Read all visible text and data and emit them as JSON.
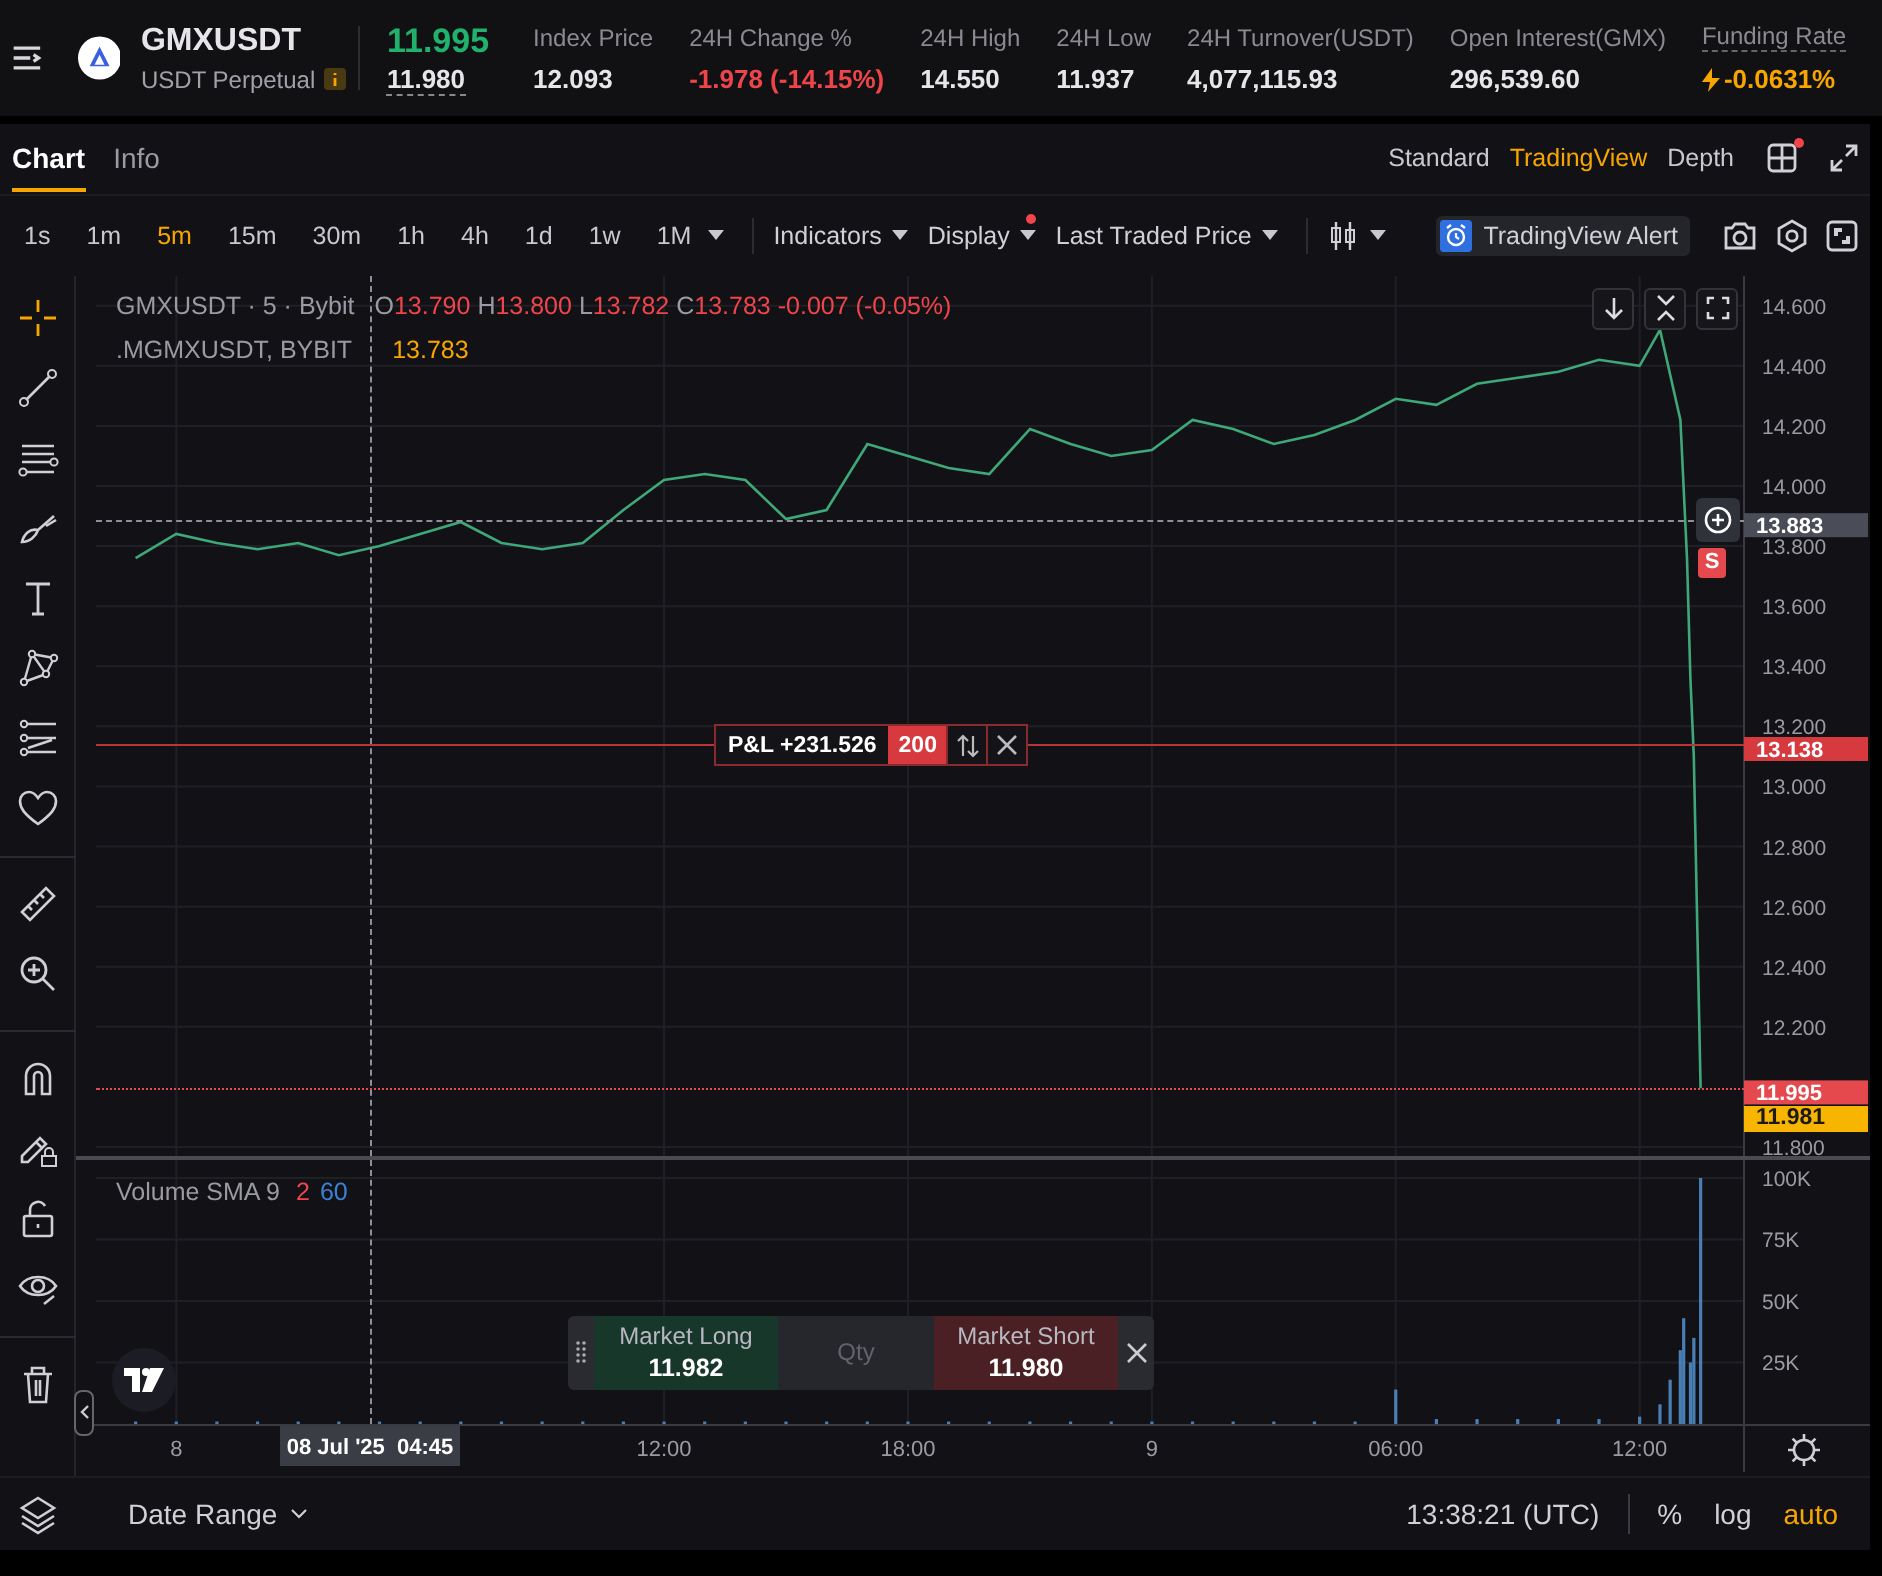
{
  "header": {
    "symbol": "GMXUSDT",
    "contract": "USDT Perpetual",
    "last_price": "11.995",
    "mark_price": "11.980",
    "stats": [
      {
        "label": "Index Price",
        "value": "12.093",
        "kind": "plain"
      },
      {
        "label": "24H Change %",
        "value": "-1.978 (-14.15%)",
        "kind": "down"
      },
      {
        "label": "24H High",
        "value": "14.550",
        "kind": "plain"
      },
      {
        "label": "24H Low",
        "value": "11.937",
        "kind": "plain"
      },
      {
        "label": "24H Turnover(USDT)",
        "value": "4,077,115.93",
        "kind": "plain"
      },
      {
        "label": "Open Interest(GMX)",
        "value": "296,539.60",
        "kind": "plain"
      },
      {
        "label": "Funding Rate",
        "value": "-0.0631%",
        "kind": "funding"
      }
    ]
  },
  "tabs": [
    {
      "label": "Chart",
      "selected": true
    },
    {
      "label": "Info",
      "selected": false
    }
  ],
  "views": [
    {
      "label": "Standard",
      "selected": false
    },
    {
      "label": "TradingView",
      "selected": true
    },
    {
      "label": "Depth",
      "selected": false
    }
  ],
  "layout_badge": true,
  "intervals": [
    {
      "label": "1s",
      "selected": false
    },
    {
      "label": "1m",
      "selected": false
    },
    {
      "label": "5m",
      "selected": true
    },
    {
      "label": "15m",
      "selected": false
    },
    {
      "label": "30m",
      "selected": false
    },
    {
      "label": "1h",
      "selected": false
    },
    {
      "label": "4h",
      "selected": false
    },
    {
      "label": "1d",
      "selected": false
    },
    {
      "label": "1w",
      "selected": false
    },
    {
      "label": "1M",
      "selected": false
    }
  ],
  "toolbar": {
    "indicators": "Indicators",
    "display": "Display",
    "display_badge": true,
    "price_source": "Last Traded Price",
    "alert": "TradingView Alert"
  },
  "legend": {
    "title": "GMXUSDT · 5 · Bybit",
    "ohlc": [
      {
        "prefix": "O",
        "value": "13.790"
      },
      {
        "prefix": "H",
        "value": "13.800"
      },
      {
        "prefix": "L",
        "value": "13.782"
      },
      {
        "prefix": "C",
        "value": "13.783"
      }
    ],
    "change": "-0.007 (-0.05%)",
    "index_name": ".MGMXUSDT, BYBIT",
    "index_value": "13.783"
  },
  "price_tags": [
    {
      "kind": "crosshair",
      "value": "13.883"
    },
    {
      "kind": "position",
      "value": "13.138"
    },
    {
      "kind": "last",
      "value": "11.995"
    }
  ],
  "crosshair_time": "08 Jul '25  04:45",
  "mark_tag": "11.981",
  "position": {
    "pnl": "P&L +231.526",
    "qty": "200"
  },
  "sell_marker": "S",
  "price_chart": {
    "chart_data": {
      "type": "line",
      "grid": true,
      "x": [
        "2025-07-07T23:00",
        "2025-07-08T00:00",
        "2025-07-08T01:00",
        "2025-07-08T02:00",
        "2025-07-08T03:00",
        "2025-07-08T04:00",
        "2025-07-08T05:00",
        "2025-07-08T06:00",
        "2025-07-08T07:00",
        "2025-07-08T08:00",
        "2025-07-08T09:00",
        "2025-07-08T10:00",
        "2025-07-08T11:00",
        "2025-07-08T12:00",
        "2025-07-08T13:00",
        "2025-07-08T14:00",
        "2025-07-08T15:00",
        "2025-07-08T16:00",
        "2025-07-08T17:00",
        "2025-07-08T18:00",
        "2025-07-08T19:00",
        "2025-07-08T20:00",
        "2025-07-08T21:00",
        "2025-07-08T22:00",
        "2025-07-08T23:00",
        "2025-07-09T00:00",
        "2025-07-09T01:00",
        "2025-07-09T02:00",
        "2025-07-09T03:00",
        "2025-07-09T04:00",
        "2025-07-09T05:00",
        "2025-07-09T06:00",
        "2025-07-09T07:00",
        "2025-07-09T08:00",
        "2025-07-09T09:00",
        "2025-07-09T10:00",
        "2025-07-09T11:00",
        "2025-07-09T12:00",
        "2025-07-09T12:30",
        "2025-07-09T13:00",
        "2025-07-09T13:10",
        "2025-07-09T13:15",
        "2025-07-09T13:20",
        "2025-07-09T13:30"
      ],
      "series": [
        {
          "color": "#3fa878",
          "values": [
            13.76,
            13.84,
            13.81,
            13.79,
            13.81,
            13.77,
            13.8,
            13.84,
            13.88,
            13.81,
            13.79,
            13.81,
            13.92,
            14.02,
            14.04,
            14.02,
            13.89,
            13.92,
            14.14,
            14.1,
            14.06,
            14.04,
            14.19,
            14.14,
            14.1,
            14.12,
            14.22,
            14.19,
            14.14,
            14.17,
            14.22,
            14.29,
            14.27,
            14.34,
            14.36,
            14.38,
            14.42,
            14.4,
            14.52,
            14.22,
            13.76,
            13.36,
            13.1,
            11.995
          ]
        }
      ],
      "xlim": [
        "2025-07-07T21:32",
        "2025-07-09T17:40"
      ],
      "ylim": [
        11.77,
        14.699
      ],
      "yticks": [
        {
          "value": 14.6,
          "label": "14.600"
        },
        {
          "value": 14.4,
          "label": "14.400"
        },
        {
          "value": 14.2,
          "label": "14.200"
        },
        {
          "value": 14,
          "label": "14.000"
        },
        {
          "value": 13.8,
          "label": "13.800"
        },
        {
          "value": 13.6,
          "label": "13.600"
        },
        {
          "value": 13.4,
          "label": "13.400"
        },
        {
          "value": 13.2,
          "label": "13.200"
        },
        {
          "value": 13,
          "label": "13.000"
        },
        {
          "value": 12.8,
          "label": "12.800"
        },
        {
          "value": 12.6,
          "label": "12.600"
        },
        {
          "value": 12.4,
          "label": "12.400"
        },
        {
          "value": 12.2,
          "label": "12.200"
        },
        {
          "value": 11.8,
          "label": "11.800"
        }
      ]
    }
  },
  "volume": {
    "title": "Volume SMA 9",
    "param_1": "2",
    "param_2": "60",
    "chart_data": {
      "type": "bar",
      "grid": true,
      "x": [
        "2025-07-07T23:00",
        "2025-07-08T00:00",
        "2025-07-08T01:00",
        "2025-07-08T02:00",
        "2025-07-08T03:00",
        "2025-07-08T04:00",
        "2025-07-08T05:00",
        "2025-07-08T06:00",
        "2025-07-08T07:00",
        "2025-07-08T08:00",
        "2025-07-08T09:00",
        "2025-07-08T10:00",
        "2025-07-08T11:00",
        "2025-07-08T12:00",
        "2025-07-08T13:00",
        "2025-07-08T14:00",
        "2025-07-08T15:00",
        "2025-07-08T16:00",
        "2025-07-08T17:00",
        "2025-07-08T18:00",
        "2025-07-08T19:00",
        "2025-07-08T20:00",
        "2025-07-08T21:00",
        "2025-07-08T22:00",
        "2025-07-08T23:00",
        "2025-07-09T00:00",
        "2025-07-09T01:00",
        "2025-07-09T02:00",
        "2025-07-09T03:00",
        "2025-07-09T04:00",
        "2025-07-09T05:00",
        "2025-07-09T06:00",
        "2025-07-09T07:00",
        "2025-07-09T08:00",
        "2025-07-09T09:00",
        "2025-07-09T10:00",
        "2025-07-09T11:00",
        "2025-07-09T12:00",
        "2025-07-09T12:30",
        "2025-07-09T12:45",
        "2025-07-09T13:00",
        "2025-07-09T13:05",
        "2025-07-09T13:15",
        "2025-07-09T13:20",
        "2025-07-09T13:30"
      ],
      "series": [
        {
          "color": "#4a7fb5",
          "values": [
            1000,
            1000,
            1000,
            1000,
            1000,
            1000,
            1000,
            1000,
            1000,
            1000,
            1000,
            1000,
            1000,
            1000,
            1000,
            1000,
            1000,
            1000,
            1000,
            1000,
            1000,
            1000,
            1000,
            1000,
            1000,
            1000,
            1000,
            1000,
            1000,
            1000,
            1000,
            14000,
            2000,
            2000,
            2000,
            2000,
            2000,
            3000,
            8000,
            18000,
            30000,
            43000,
            25000,
            35000,
            100000
          ]
        }
      ],
      "xlim": [
        "2025-07-07T21:32",
        "2025-07-09T17:40"
      ],
      "ylim": [
        0,
        107300
      ],
      "xticks": [
        {
          "value": "2025-07-08T00:00",
          "label": "8"
        },
        {
          "value": "2025-07-08T12:00",
          "label": "12:00"
        },
        {
          "value": "2025-07-08T18:00",
          "label": "18:00"
        },
        {
          "value": "2025-07-09T00:00",
          "label": "9"
        },
        {
          "value": "2025-07-09T06:00",
          "label": "06:00"
        },
        {
          "value": "2025-07-09T12:00",
          "label": "12:00"
        }
      ],
      "yticks": [
        {
          "value": 100000,
          "label": "100K"
        },
        {
          "value": 75000,
          "label": "75K"
        },
        {
          "value": 50000,
          "label": "50K"
        },
        {
          "value": 25000,
          "label": "25K"
        }
      ]
    }
  },
  "order_panel": {
    "long_label": "Market Long",
    "long_price": "11.982",
    "qty_placeholder": "Qty",
    "short_label": "Market Short",
    "short_price": "11.980"
  },
  "footer": {
    "date_range": "Date Range",
    "time": "13:38:21 (UTC)",
    "scale_modes": [
      {
        "label": "%",
        "selected": false
      },
      {
        "label": "log",
        "selected": false
      },
      {
        "label": "auto",
        "selected": true
      }
    ]
  }
}
